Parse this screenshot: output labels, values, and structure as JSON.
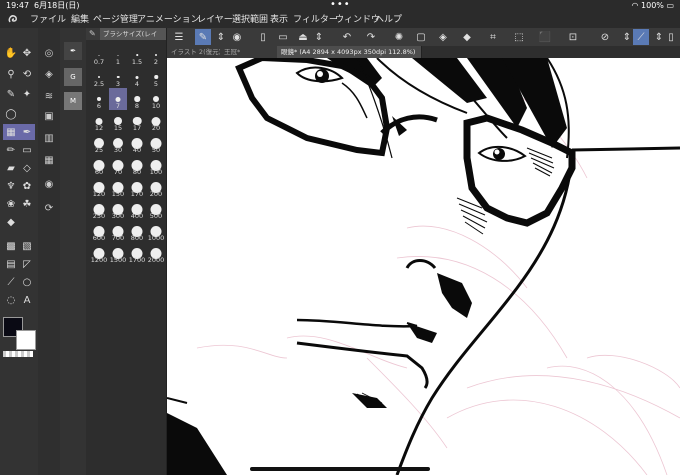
{
  "status": {
    "time": "19:47",
    "date": "6月18日(日)",
    "battery": "100%",
    "wifi_icon": "wifi-icon"
  },
  "menu": [
    "ファイル",
    "編集",
    "ページ管理",
    "アニメーション",
    "レイヤー",
    "選択範囲",
    "表示",
    "フィルター",
    "ウィンドウ",
    "ヘルプ"
  ],
  "tabs": [
    {
      "label": "イラスト 2(復元)",
      "active": false
    },
    {
      "label": "王冠*",
      "active": false
    },
    {
      "label": "眼鏡* (A4 2894 x 4093px 350dpi 112.8%)",
      "active": true
    }
  ],
  "brush_panel": {
    "title": "ブラシサイズ(レイ",
    "sizes": [
      "0.7",
      "1",
      "1.5",
      "2",
      "2.5",
      "3",
      "4",
      "5",
      "6",
      "7",
      "8",
      "10",
      "12",
      "15",
      "17",
      "20",
      "25",
      "30",
      "40",
      "50",
      "60",
      "70",
      "80",
      "100",
      "120",
      "150",
      "170",
      "200",
      "250",
      "300",
      "400",
      "500",
      "600",
      "700",
      "800",
      "1000",
      "1200",
      "1500",
      "1700",
      "2000"
    ],
    "selected": "7"
  },
  "colors": {
    "foreground": "#0a0a14",
    "background": "#ffffff",
    "accent": "#5a7ab5"
  }
}
